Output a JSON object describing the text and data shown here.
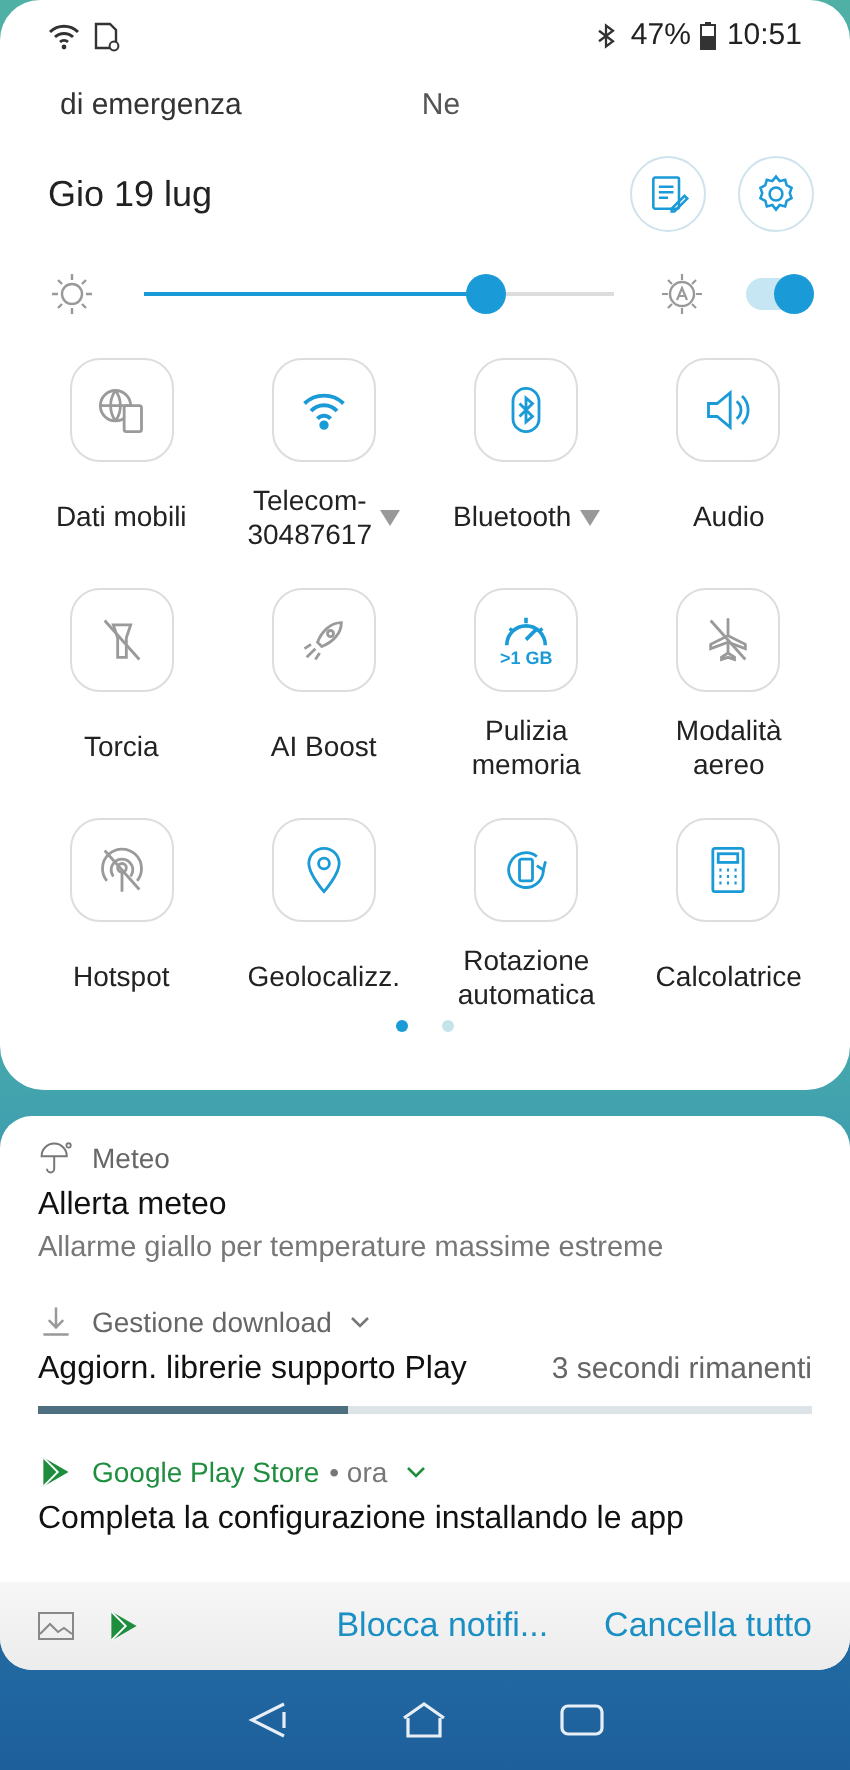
{
  "status_bar": {
    "battery": "47%",
    "time": "10:51"
  },
  "ticker": [
    "di emergenza",
    "Ne"
  ],
  "date": "Gio 19 lug",
  "brightness": {
    "level": 0.67,
    "auto": true
  },
  "tiles": [
    {
      "label": "Dati mobili",
      "on": false,
      "dropdown": false
    },
    {
      "label": "Telecom-\n30487617",
      "on": true,
      "dropdown": true
    },
    {
      "label": "Bluetooth",
      "on": true,
      "dropdown": true
    },
    {
      "label": "Audio",
      "on": true,
      "dropdown": false
    },
    {
      "label": "Torcia",
      "on": false,
      "dropdown": false
    },
    {
      "label": "AI Boost",
      "on": false,
      "dropdown": false
    },
    {
      "label": "Pulizia\nmemoria",
      "on": true,
      "dropdown": false,
      "badge": ">1 GB"
    },
    {
      "label": "Modalità\naereo",
      "on": false,
      "dropdown": false
    },
    {
      "label": "Hotspot",
      "on": false,
      "dropdown": false
    },
    {
      "label": "Geolocalizz.",
      "on": true,
      "dropdown": false
    },
    {
      "label": "Rotazione\nautomatica",
      "on": true,
      "dropdown": false
    },
    {
      "label": "Calcolatrice",
      "on": true,
      "dropdown": false
    }
  ],
  "pages": [
    {
      "selected": true
    },
    {
      "selected": false
    }
  ],
  "notifications": [
    {
      "kind": "alert",
      "app": "Meteo",
      "title": "Allerta meteo",
      "text": "Allarme giallo per temperature massime estreme"
    },
    {
      "kind": "progress",
      "app": "Gestione download",
      "title": "Aggiorn. librerie supporto Play",
      "info": "3 secondi rimanenti",
      "level": 0.4
    },
    {
      "kind": "store",
      "app": "Google Play Store",
      "time": "• ora",
      "title": "Completa la configurazione installando le app"
    }
  ],
  "actions": [
    "Blocca notifi...",
    "Cancella tutto"
  ]
}
